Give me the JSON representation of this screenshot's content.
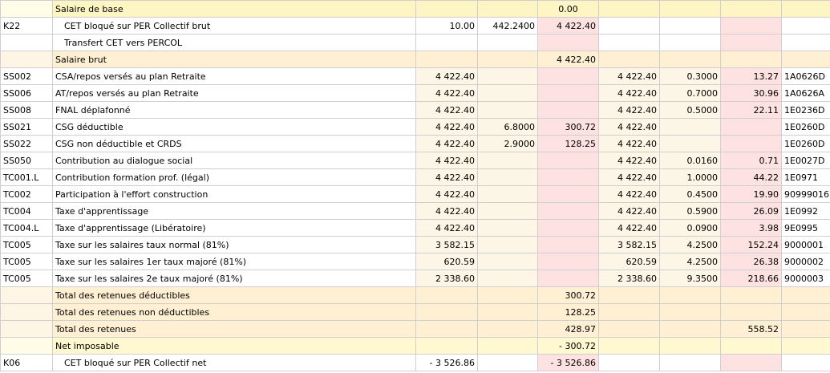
{
  "rows": [
    {
      "type": "base",
      "code": "",
      "label": "Salaire de base",
      "c2": "",
      "c3": "",
      "c4": "0.00",
      "c5": "",
      "c6": "",
      "c7": "",
      "ref": ""
    },
    {
      "type": "sub",
      "code": "K22",
      "label": "CET bloqué sur PER Collectif brut",
      "c2": "10.00",
      "c3": "442.2400",
      "c4": "4 422.40",
      "c5": "",
      "c6": "",
      "c7": "",
      "ref": ""
    },
    {
      "type": "sub",
      "code": "",
      "label": "Transfert CET vers PERCOL",
      "c2": "",
      "c3": "",
      "c4": "",
      "c5": "",
      "c6": "",
      "c7": "",
      "ref": ""
    },
    {
      "type": "total",
      "code": "",
      "label": "Salaire brut",
      "c2": "",
      "c3": "",
      "c4": "4 422.40",
      "c5": "",
      "c6": "",
      "c7": "",
      "ref": ""
    },
    {
      "type": "norm",
      "code": "SS002",
      "label": "CSA/repos versés au plan Retraite",
      "c2": "4 422.40",
      "c3": "",
      "c4": "",
      "c5": "4 422.40",
      "c6": "0.3000",
      "c7": "13.27",
      "ref": "1A0626D"
    },
    {
      "type": "norm",
      "code": "SS006",
      "label": "AT/repos versés au plan Retraite",
      "c2": "4 422.40",
      "c3": "",
      "c4": "",
      "c5": "4 422.40",
      "c6": "0.7000",
      "c7": "30.96",
      "ref": "1A0626A"
    },
    {
      "type": "norm",
      "code": "SS008",
      "label": "FNAL déplafonné",
      "c2": "4 422.40",
      "c3": "",
      "c4": "",
      "c5": "4 422.40",
      "c6": "0.5000",
      "c7": "22.11",
      "ref": "1E0236D"
    },
    {
      "type": "norm",
      "code": "SS021",
      "label": "CSG déductible",
      "c2": "4 422.40",
      "c3": "6.8000",
      "c4": "300.72",
      "c5": "4 422.40",
      "c6": "",
      "c7": "",
      "ref": "1E0260D"
    },
    {
      "type": "norm",
      "code": "SS022",
      "label": "CSG non déductible et CRDS",
      "c2": "4 422.40",
      "c3": "2.9000",
      "c4": "128.25",
      "c5": "4 422.40",
      "c6": "",
      "c7": "",
      "ref": "1E0260D"
    },
    {
      "type": "norm",
      "code": "SS050",
      "label": "Contribution au dialogue social",
      "c2": "4 422.40",
      "c3": "",
      "c4": "",
      "c5": "4 422.40",
      "c6": "0.0160",
      "c7": "0.71",
      "ref": "1E0027D"
    },
    {
      "type": "norm",
      "code": "TC001.L",
      "label": "Contribution formation prof. (légal)",
      "c2": "4 422.40",
      "c3": "",
      "c4": "",
      "c5": "4 422.40",
      "c6": "1.0000",
      "c7": "44.22",
      "ref": "1E0971"
    },
    {
      "type": "norm",
      "code": "TC002",
      "label": "Participation à l'effort construction",
      "c2": "4 422.40",
      "c3": "",
      "c4": "",
      "c5": "4 422.40",
      "c6": "0.4500",
      "c7": "19.90",
      "ref": "90999016"
    },
    {
      "type": "norm",
      "code": "TC004",
      "label": "Taxe d'apprentissage",
      "c2": "4 422.40",
      "c3": "",
      "c4": "",
      "c5": "4 422.40",
      "c6": "0.5900",
      "c7": "26.09",
      "ref": "1E0992"
    },
    {
      "type": "norm",
      "code": "TC004.L",
      "label": "Taxe d'apprentissage (Libératoire)",
      "c2": "4 422.40",
      "c3": "",
      "c4": "",
      "c5": "4 422.40",
      "c6": "0.0900",
      "c7": "3.98",
      "ref": "9E0995"
    },
    {
      "type": "norm",
      "code": "TC005",
      "label": "Taxe sur les salaires taux normal (81%)",
      "c2": "3 582.15",
      "c3": "",
      "c4": "",
      "c5": "3 582.15",
      "c6": "4.2500",
      "c7": "152.24",
      "ref": "9000001"
    },
    {
      "type": "norm",
      "code": "TC005",
      "label": "Taxe sur les salaires 1er taux majoré (81%)",
      "c2": "620.59",
      "c3": "",
      "c4": "",
      "c5": "620.59",
      "c6": "4.2500",
      "c7": "26.38",
      "ref": "9000002"
    },
    {
      "type": "norm",
      "code": "TC005",
      "label": "Taxe sur les salaires 2e taux majoré (81%)",
      "c2": "2 338.60",
      "c3": "",
      "c4": "",
      "c5": "2 338.60",
      "c6": "9.3500",
      "c7": "218.66",
      "ref": "9000003"
    },
    {
      "type": "total",
      "code": "",
      "label": "Total des retenues déductibles",
      "c2": "",
      "c3": "",
      "c4": "300.72",
      "c5": "",
      "c6": "",
      "c7": "",
      "ref": ""
    },
    {
      "type": "total",
      "code": "",
      "label": "Total des retenues non déductibles",
      "c2": "",
      "c3": "",
      "c4": "128.25",
      "c5": "",
      "c6": "",
      "c7": "",
      "ref": ""
    },
    {
      "type": "total",
      "code": "",
      "label": "Total des retenues",
      "c2": "",
      "c3": "",
      "c4": "428.97",
      "c5": "",
      "c6": "",
      "c7": "558.52",
      "ref": ""
    },
    {
      "type": "net",
      "code": "",
      "label": "Net imposable",
      "c2": "",
      "c3": "",
      "c4": "- 300.72",
      "c5": "",
      "c6": "",
      "c7": "",
      "ref": ""
    },
    {
      "type": "sub",
      "code": "K06",
      "label": "CET bloqué sur PER Collectif net",
      "c2": "- 3 526.86",
      "c3": "",
      "c4": "- 3 526.86",
      "c5": "",
      "c6": "",
      "c7": "",
      "ref": ""
    }
  ]
}
